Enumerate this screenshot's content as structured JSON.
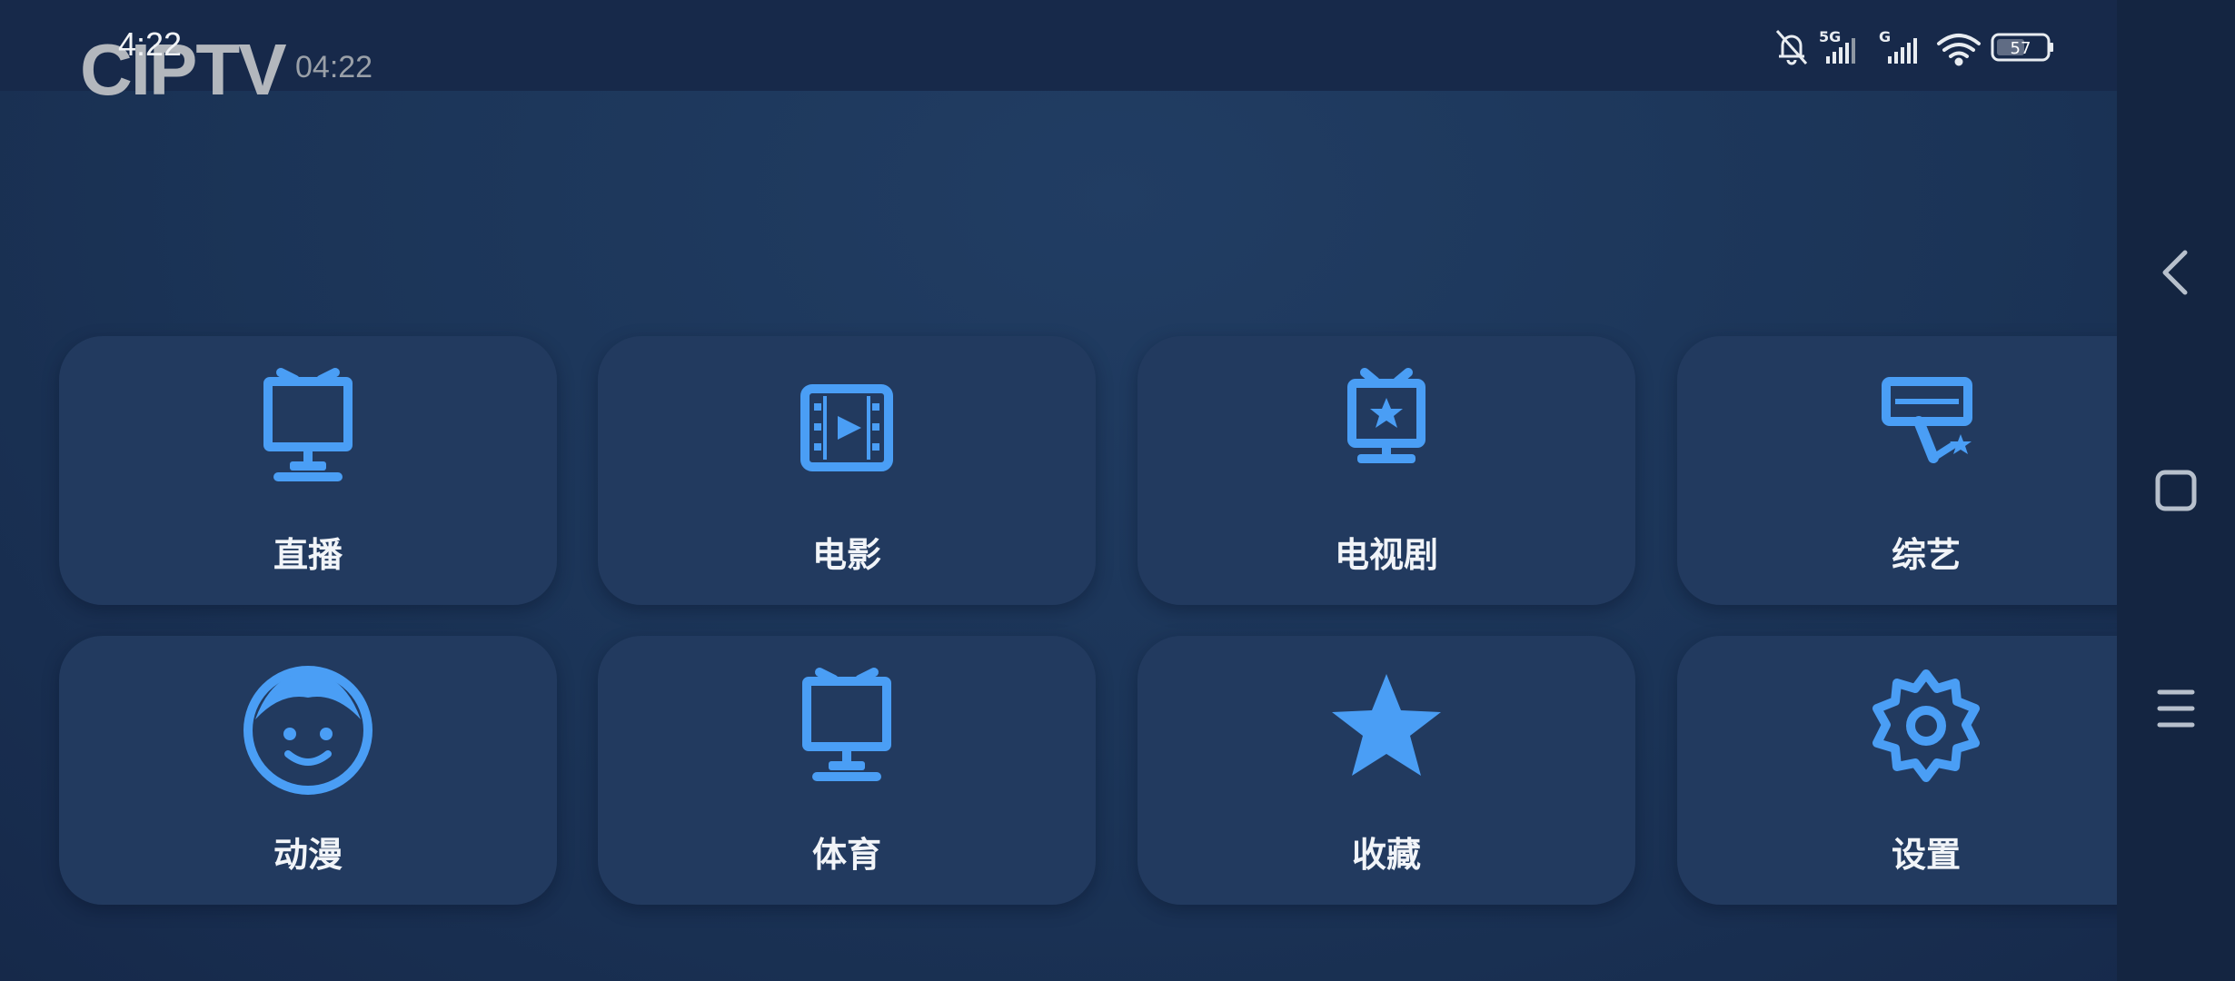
{
  "status_bar": {
    "time": "4:22",
    "battery": "57"
  },
  "header": {
    "brand": "CIPTV",
    "time": "04:22"
  },
  "accent_color": "#4a9ef5",
  "tiles": [
    {
      "label": "直播",
      "icon": "tv-icon"
    },
    {
      "label": "电影",
      "icon": "film-icon"
    },
    {
      "label": "电视剧",
      "icon": "tv-star-icon"
    },
    {
      "label": "综艺",
      "icon": "variety-show-icon"
    },
    {
      "label": "动漫",
      "icon": "smiley-face-icon"
    },
    {
      "label": "体育",
      "icon": "sports-tv-icon"
    },
    {
      "label": "收藏",
      "icon": "star-icon"
    },
    {
      "label": "设置",
      "icon": "gear-icon"
    }
  ],
  "nav_bar": {
    "back": "back-icon",
    "home": "home-icon",
    "menu": "menu-icon"
  }
}
